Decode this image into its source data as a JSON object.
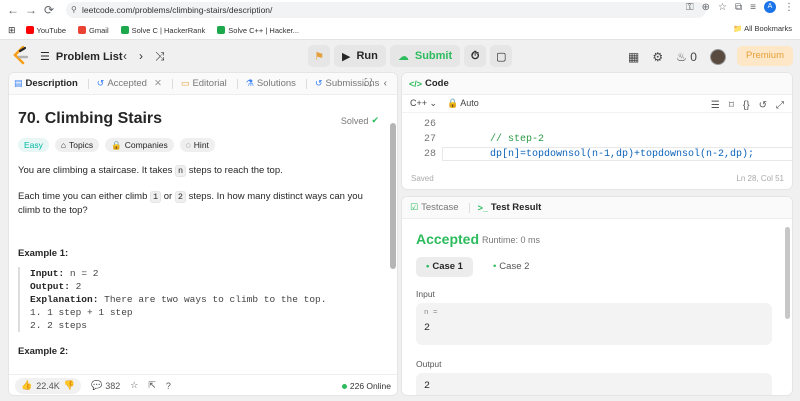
{
  "browser": {
    "url": "leetcode.com/problems/climbing-stairs/description/",
    "bookmarks": [
      {
        "label": "YouTube",
        "color": "#ff0000"
      },
      {
        "label": "Gmail",
        "color": "#ea4335"
      },
      {
        "label": "Solve C | HackerRank",
        "color": "#1ba94c"
      },
      {
        "label": "Solve C++ | Hacker...",
        "color": "#1ba94c"
      }
    ],
    "all_bookmarks": "All Bookmarks",
    "profile_letter": "A"
  },
  "topbar": {
    "problem_list": "Problem List",
    "run": "Run",
    "submit": "Submit",
    "streak": "0",
    "premium": "Premium"
  },
  "left_panel": {
    "tabs": [
      "Description",
      "Accepted",
      "Editorial",
      "Solutions",
      "Submissions"
    ],
    "title": "70. Climbing Stairs",
    "solved": "Solved",
    "chips": [
      "Easy",
      "Topics",
      "Companies",
      "Hint"
    ],
    "para1_a": "You are climbing a staircase. It takes ",
    "para1_code": "n",
    "para1_b": " steps to reach the top.",
    "para2_a": "Each time you can either climb ",
    "para2_c1": "1",
    "para2_b": " or ",
    "para2_c2": "2",
    "para2_c": " steps. In how many distinct ways can you climb to the top?",
    "example1_title": "Example 1:",
    "ex_input_label": "Input:",
    "ex_input_value": "n = 2",
    "ex_output_label": "Output:",
    "ex_output_value": "2",
    "ex_expl_label": "Explanation:",
    "ex_expl_value": "There are two ways to climb to the top.",
    "ex_line1": "1. 1 step + 1 step",
    "ex_line2": "2. 2 steps",
    "example2_title": "Example 2:",
    "likes": "22.4K",
    "comments": "382",
    "online": "226 Online"
  },
  "code_panel": {
    "tab": "Code",
    "language": "C++",
    "mode": "Auto",
    "lines": [
      {
        "num": "26",
        "text": ""
      },
      {
        "num": "27",
        "text": "// step-2"
      },
      {
        "num": "28",
        "text": "dp[n]=topdownsol(n-1,dp)+topdownsol(n-2,dp);"
      }
    ],
    "saved": "Saved",
    "cursor": "Ln 28, Col 51"
  },
  "result_panel": {
    "tabs": [
      "Testcase",
      "Test Result"
    ],
    "status": "Accepted",
    "runtime": "Runtime: 0 ms",
    "cases": [
      "Case 1",
      "Case 2"
    ],
    "input_label": "Input",
    "input_key": "n =",
    "input_value": "2",
    "output_label": "Output",
    "output_value": "2"
  }
}
